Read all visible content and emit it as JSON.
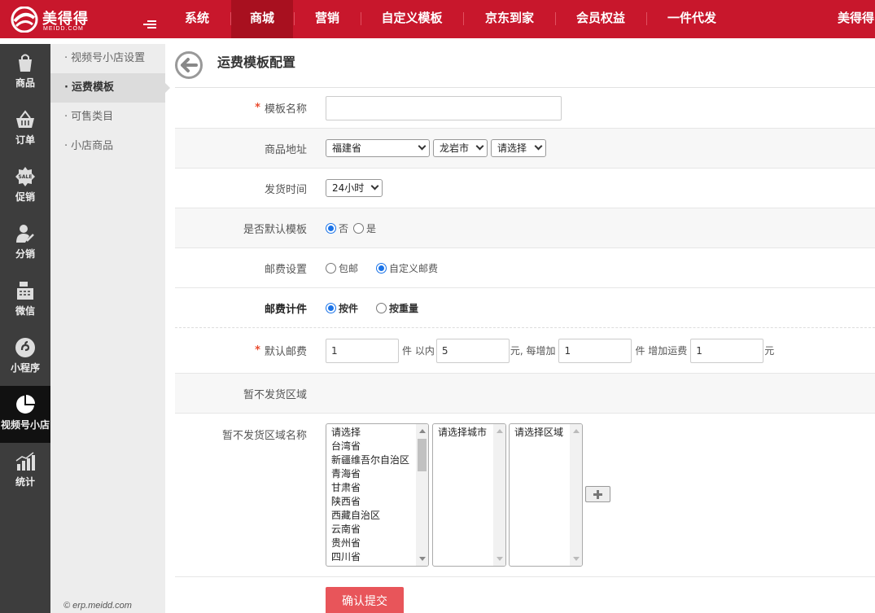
{
  "brand": {
    "name": "美得得",
    "sub": "MEIDD.COM"
  },
  "topnav": {
    "items": [
      "系统",
      "商城",
      "营销",
      "自定义模板",
      "京东到家",
      "会员权益",
      "一件代发"
    ],
    "active": "商城",
    "user": "美得得"
  },
  "sidebar": {
    "items": [
      {
        "label": "商品",
        "icon": "bag-icon"
      },
      {
        "label": "订单",
        "icon": "basket-icon"
      },
      {
        "label": "促销",
        "icon": "sale-badge-icon"
      },
      {
        "label": "分销",
        "icon": "person-share-icon"
      },
      {
        "label": "微信",
        "icon": "cash-register-icon"
      },
      {
        "label": "小程序",
        "icon": "miniprogram-icon"
      },
      {
        "label": "视频号小店",
        "icon": "pie-chart-icon"
      },
      {
        "label": "统计",
        "icon": "bar-chart-icon"
      }
    ],
    "active": "视频号小店"
  },
  "subnav": {
    "items": [
      "视频号小店设置",
      "运费模板",
      "可售类目",
      "小店商品"
    ],
    "active": "运费模板",
    "copyright": "© erp.meidd.com"
  },
  "page": {
    "title": "运费模板配置"
  },
  "form": {
    "template_name": {
      "label": "模板名称",
      "value": ""
    },
    "address": {
      "label": "商品地址",
      "province": "福建省",
      "city": "龙岩市",
      "district": "请选择"
    },
    "ship_time": {
      "label": "发货时间",
      "value": "24小时"
    },
    "is_default": {
      "label": "是否默认模板",
      "opt_no": "否",
      "opt_yes": "是",
      "selected": "否"
    },
    "postage_setting": {
      "label": "邮费设置",
      "opt_free": "包邮",
      "opt_custom": "自定义邮费",
      "selected": "自定义邮费"
    },
    "billing": {
      "label": "邮费计件",
      "opt_piece": "按件",
      "opt_weight": "按重量",
      "selected": "按件"
    },
    "default_postage": {
      "label": "默认邮费",
      "first_qty": "1",
      "txt_within": "件 以内",
      "first_fee": "5",
      "txt_each": "元, 每增加",
      "add_qty": "1",
      "txt_add": "件 增加运费",
      "add_fee": "1",
      "txt_yuan": "元"
    },
    "no_ship_area": {
      "label": "暂不发货区域"
    },
    "no_ship_area_name": {
      "label": "暂不发货区域名称",
      "provinces": [
        "请选择",
        "台湾省",
        "新疆维吾尔自治区",
        "青海省",
        "甘肃省",
        "陕西省",
        "西藏自治区",
        "云南省",
        "贵州省",
        "四川省"
      ],
      "city_placeholder": "请选择城市",
      "district_placeholder": "请选择区域"
    },
    "submit_label": "确认提交"
  }
}
